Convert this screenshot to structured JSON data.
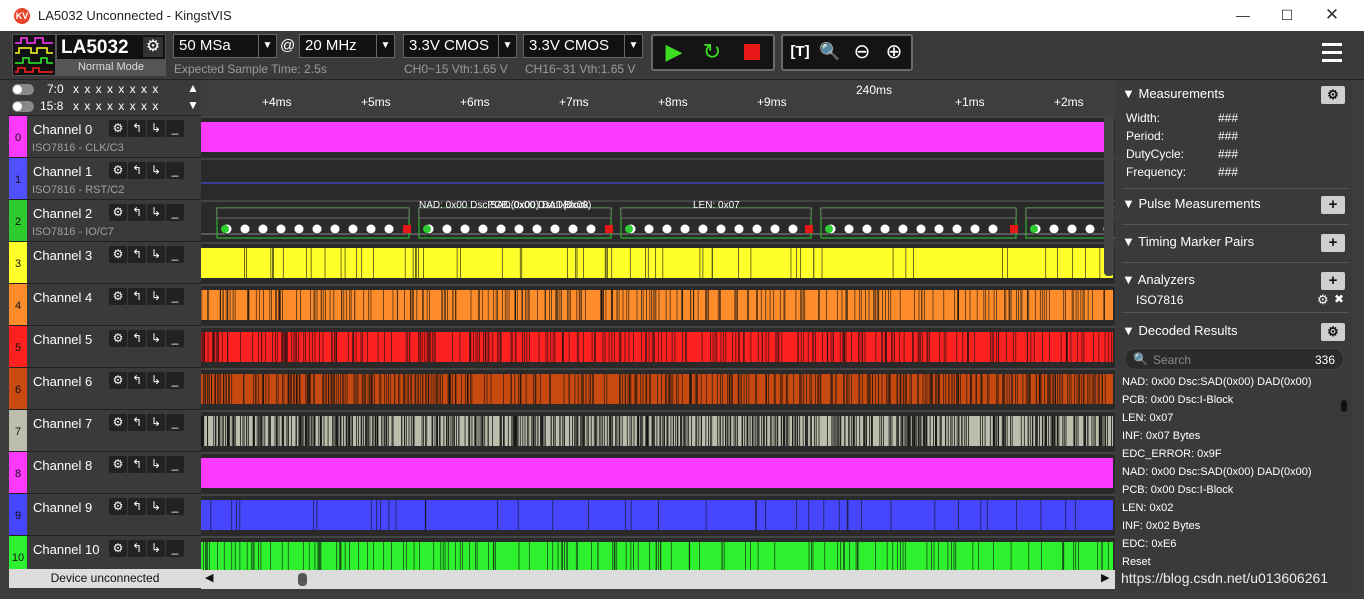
{
  "window": {
    "title": "LA5032 Unconnected - KingstVIS",
    "logo": "KV"
  },
  "toolbar": {
    "device": "LA5032",
    "mode": "Normal Mode",
    "sample_depth": "50 MSa",
    "at": "@",
    "sample_rate": "20 MHz",
    "expected": "Expected Sample Time: 2.5s",
    "vth1": "3.3V CMOS",
    "vth1_sub": "CH0~15 Vth:1.65 V",
    "vth2": "3.3V CMOS",
    "vth2_sub": "CH16~31 Vth:1.65 V"
  },
  "bits": [
    {
      "label": "7:0",
      "values": "x x x x x x x x"
    },
    {
      "label": "15:8",
      "values": "x x x x x x x x"
    }
  ],
  "channels": [
    {
      "num": "0",
      "name": "Channel 0",
      "sub": "ISO7816 - CLK/C3",
      "color": "#ff3aff"
    },
    {
      "num": "1",
      "name": "Channel 1",
      "sub": "ISO7816 - RST/C2",
      "color": "#5050ff"
    },
    {
      "num": "2",
      "name": "Channel 2",
      "sub": "ISO7816 - IO/C7",
      "color": "#2ecc2e"
    },
    {
      "num": "3",
      "name": "Channel 3",
      "sub": "",
      "color": "#ffff2a"
    },
    {
      "num": "4",
      "name": "Channel 4",
      "sub": "",
      "color": "#ff8c2a"
    },
    {
      "num": "5",
      "name": "Channel 5",
      "sub": "",
      "color": "#ff2020"
    },
    {
      "num": "6",
      "name": "Channel 6",
      "sub": "",
      "color": "#c84a10"
    },
    {
      "num": "7",
      "name": "Channel 7",
      "sub": "",
      "color": "#bdbdad"
    },
    {
      "num": "8",
      "name": "Channel 8",
      "sub": "",
      "color": "#ff3aff"
    },
    {
      "num": "9",
      "name": "Channel 9",
      "sub": "",
      "color": "#4646ff"
    },
    {
      "num": "10",
      "name": "Channel 10",
      "sub": "",
      "color": "#2ef02e"
    }
  ],
  "device_status": "Device unconnected",
  "ruler": {
    "ticks": [
      "+4ms",
      "+5ms",
      "+6ms",
      "+7ms",
      "+8ms",
      "+9ms",
      "+1ms",
      "+2ms"
    ],
    "center": "240ms"
  },
  "decode_blocks": [
    "NAD: 0x00 Dsc:SAD(0x00) DAD(0x00)",
    "PCB: 0x00 Dsc:I-Block",
    "LEN: 0x07"
  ],
  "right": {
    "measurements": "Measurements",
    "meas_items": [
      {
        "k": "Width:",
        "v": "###"
      },
      {
        "k": "Period:",
        "v": "###"
      },
      {
        "k": "DutyCycle:",
        "v": "###"
      },
      {
        "k": "Frequency:",
        "v": "###"
      }
    ],
    "pulse": "Pulse Measurements",
    "timing": "Timing Marker Pairs",
    "analyzers": "Analyzers",
    "analyzer_item": "ISO7816",
    "decoded": "Decoded Results",
    "search_placeholder": "Search",
    "count": "336",
    "results": [
      "NAD: 0x00 Dsc:SAD(0x00) DAD(0x00)",
      "PCB: 0x00 Dsc:I-Block",
      "LEN: 0x07",
      "INF: 0x07 Bytes",
      "EDC_ERROR: 0x9F",
      "NAD: 0x00 Dsc:SAD(0x00) DAD(0x00)",
      "PCB: 0x00 Dsc:I-Block",
      "LEN: 0x02",
      "INF: 0x02 Bytes",
      "EDC: 0xE6",
      "Reset"
    ]
  },
  "watermark": "https://blog.csdn.net/u013606261"
}
